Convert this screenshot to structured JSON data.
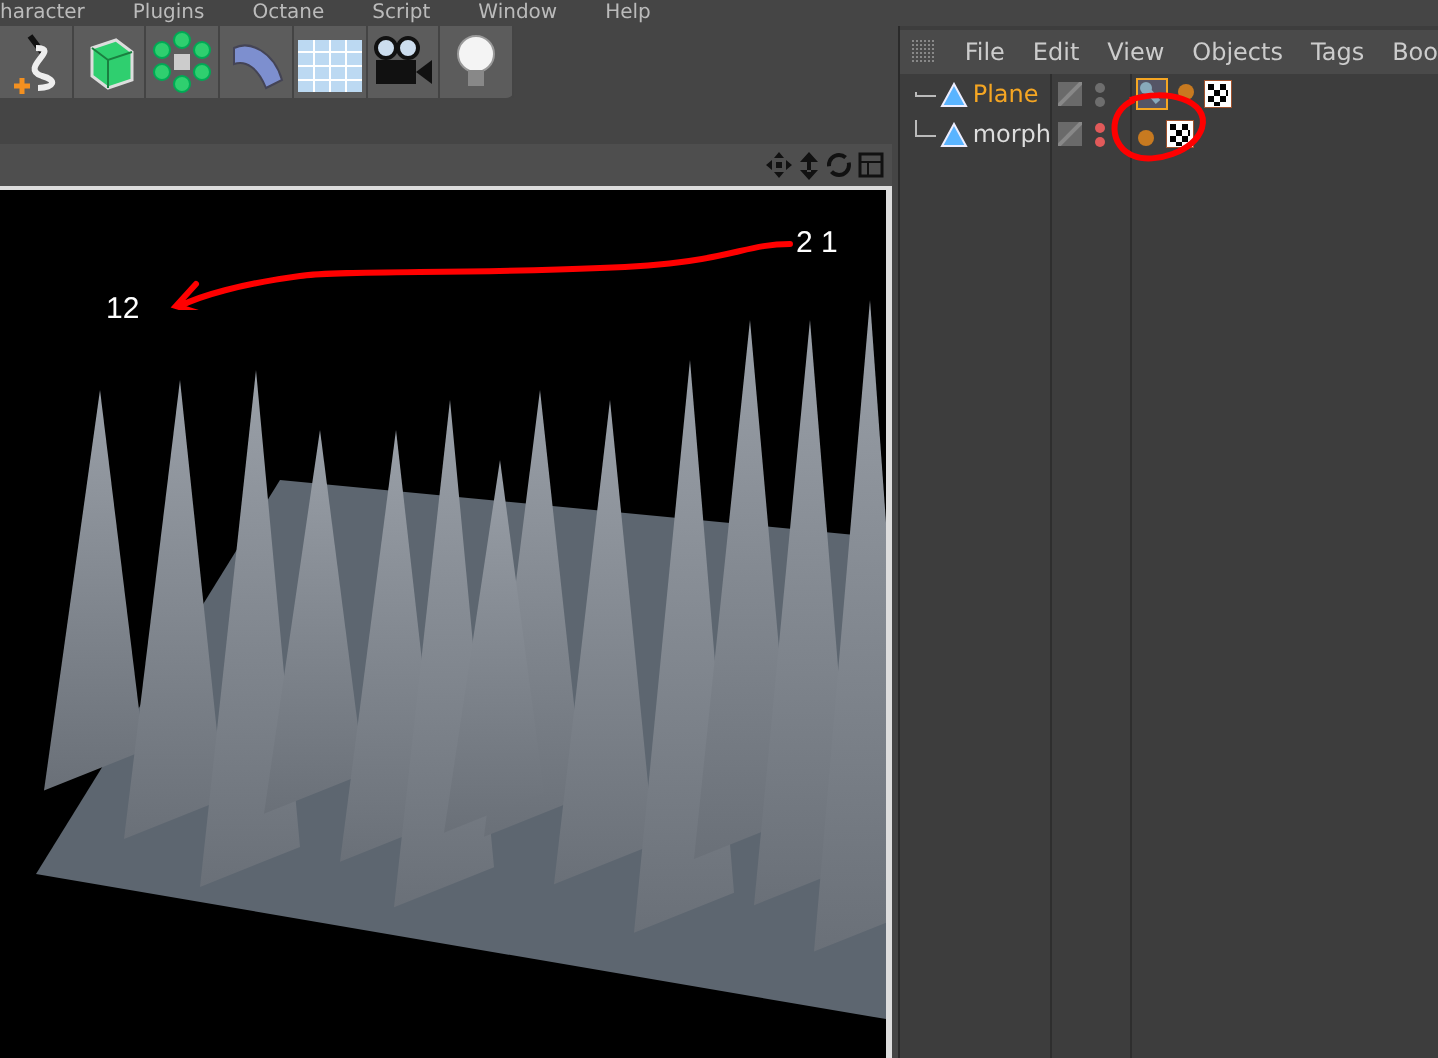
{
  "menu_bar": {
    "items": [
      "haracter",
      "Plugins",
      "Octane",
      "Script",
      "Window",
      "Help"
    ]
  },
  "viewport": {
    "annotations": [
      {
        "text": "2 1"
      },
      {
        "text": "12"
      }
    ]
  },
  "object_manager": {
    "menu": [
      "File",
      "Edit",
      "View",
      "Objects",
      "Tags",
      "Boo"
    ],
    "objects": [
      {
        "name": "Plane",
        "selected": true,
        "hidden": false
      },
      {
        "name": "morph",
        "selected": false,
        "hidden": true
      }
    ]
  }
}
